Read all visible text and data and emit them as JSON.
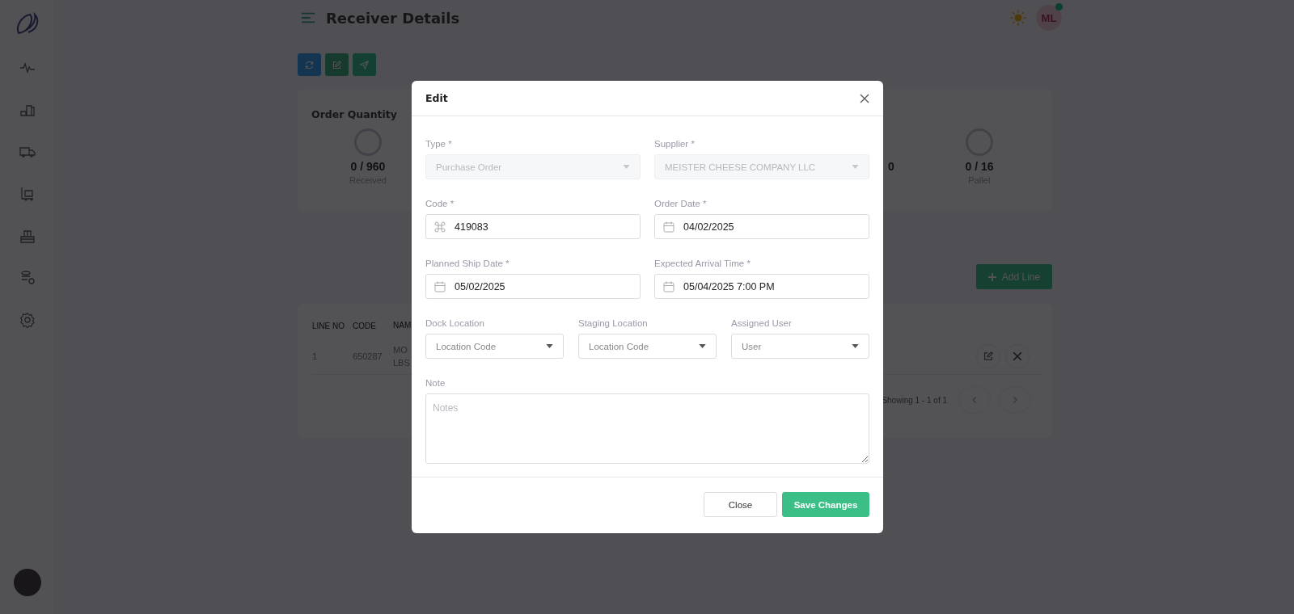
{
  "header": {
    "title": "Receiver Details",
    "avatar": {
      "initials": "ML",
      "online": true
    }
  },
  "summary": {
    "title": "Order Quantity",
    "stats": [
      {
        "value": "0 / 960",
        "label": "Received"
      },
      {
        "value": "0"
      },
      {
        "value": "0 / 16",
        "label": "Pallet"
      }
    ]
  },
  "add_line_button": "Add Line",
  "table": {
    "columns": [
      "LINE NO",
      "CODE",
      "NAM"
    ],
    "rows": [
      {
        "cells": [
          "1",
          "650287",
          "MO\nLBS"
        ]
      }
    ]
  },
  "pagination": {
    "summary": "Showing 1 - 1 of 1"
  },
  "modal": {
    "title": "Edit",
    "rows": [
      [
        {
          "kind": "select",
          "label": "Type *",
          "value": "Purchase Order",
          "disabled": true
        },
        {
          "kind": "select",
          "label": "Supplier *",
          "value": "MEISTER CHEESE COMPANY LLC",
          "disabled": true
        }
      ],
      [
        {
          "kind": "code",
          "label": "Code *",
          "value": "419083"
        },
        {
          "kind": "date",
          "label": "Order Date *",
          "value": "04/02/2025"
        }
      ],
      [
        {
          "kind": "date",
          "label": "Planned Ship Date *",
          "value": "05/02/2025"
        },
        {
          "kind": "date",
          "label": "Expected Arrival Time *",
          "value": "05/04/2025 7:00 PM"
        }
      ],
      [
        {
          "kind": "select",
          "label": "Dock Location",
          "placeholder": "Location Code",
          "disabled": false
        },
        {
          "kind": "select",
          "label": "Staging Location",
          "placeholder": "Location Code",
          "disabled": false
        },
        {
          "kind": "select",
          "label": "Assigned User",
          "placeholder": "User",
          "disabled": false
        }
      ],
      [
        {
          "kind": "textarea",
          "label": "Note",
          "placeholder": "Notes"
        }
      ]
    ],
    "buttons": [
      {
        "label": "Close",
        "kind": "secondary"
      },
      {
        "label": "Save Changes",
        "kind": "primary"
      }
    ]
  }
}
